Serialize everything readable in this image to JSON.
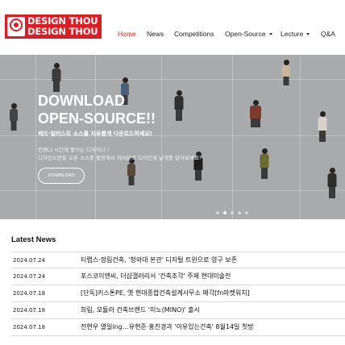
{
  "brand": {
    "logo_text_line1": "DESIGN THOU",
    "logo_text_line2": "DESIGN THOU",
    "accent_color": "#e11b22"
  },
  "nav": {
    "items": [
      {
        "label": "Home",
        "active": true,
        "has_dropdown": false
      },
      {
        "label": "News",
        "active": false,
        "has_dropdown": false
      },
      {
        "label": "Competitions",
        "active": false,
        "has_dropdown": false
      },
      {
        "label": "Open-Source",
        "active": false,
        "has_dropdown": true
      },
      {
        "label": "Lecture",
        "active": false,
        "has_dropdown": true
      },
      {
        "label": "Q&A",
        "active": false,
        "has_dropdown": false
      }
    ]
  },
  "hero": {
    "title": "DOWNLOAD\nOPEN-SOURCE!!",
    "subtitle": "캐드·일러스트 소스를 자유롭게 다운로드하세요!",
    "description": "언제나 시간에 쫓기는 디자이너 !\n디자인도면을 오픈 소스를 활용해서 여러분의 디자인에 날개를 달아보세요!",
    "button_label": "DOWNLOAD",
    "slider_dots": 5,
    "active_dot": 2
  },
  "latest_news": {
    "heading": "Latest News",
    "items": [
      {
        "date": "2024.07.24",
        "title": "티랩스·정림건축, '청와대 본관' 디지털 트윈으로 영구 보존"
      },
      {
        "date": "2024.07.24",
        "title": "포스코이앤씨, 더샵갤러리서 '건축조각' 주제 현대미술전"
      },
      {
        "date": "2024.07.18",
        "title": "[단독]키스톤PE, 옛 현대종합건축설계사무소 매각[fn마켓워치]"
      },
      {
        "date": "2024.07.18",
        "title": "희림, 모듈러 건축브랜드 '미노(MINO)' 출시"
      },
      {
        "date": "2024.07.18",
        "title": "전현우 열일ing…유현준·홍진경과 '이유있는건축' 8월14일 첫방"
      }
    ]
  }
}
